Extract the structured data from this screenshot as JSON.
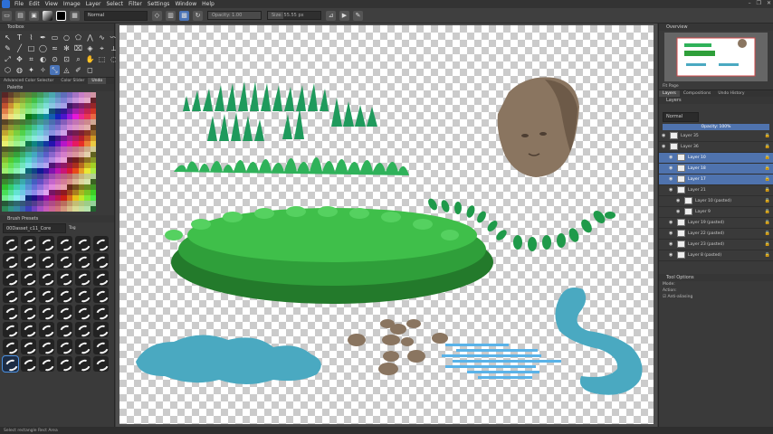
{
  "menu": [
    "File",
    "Edit",
    "View",
    "Image",
    "Layer",
    "Select",
    "Filter",
    "Settings",
    "Window",
    "Help"
  ],
  "toolbar": {
    "blend_mode": "Normal",
    "opacity_label": "Opacity: 1.00",
    "opacity_value": 1.0,
    "size_label": "Size: 55.55 px",
    "size_fraction": 0.3
  },
  "left_dock": {
    "toolbox_title": "Toolbox",
    "tabs": [
      "Advanced Color Selector",
      "Color Slider",
      "Undo"
    ],
    "palette_title": "Palette",
    "brush_title": "Brush Presets",
    "brush_filter": "00Dasset_c11_Core",
    "brush_tag": "Tag"
  },
  "right_dock": {
    "overview_title": "Overview",
    "fit_label": "Fit Page",
    "tabs": [
      "Layers",
      "Compositions",
      "Undo History"
    ],
    "layers_title": "Layers",
    "blend": "Normal",
    "opacity": "Opacity: 100%",
    "layers": [
      {
        "name": "Layer 35",
        "selected": false,
        "indent": 0
      },
      {
        "name": "Layer 36",
        "selected": false,
        "indent": 0
      },
      {
        "name": "Layer 10",
        "selected": true,
        "indent": 1
      },
      {
        "name": "Layer 18",
        "selected": true,
        "indent": 1
      },
      {
        "name": "Layer 17",
        "selected": true,
        "indent": 1
      },
      {
        "name": "Layer 21",
        "selected": false,
        "indent": 1
      },
      {
        "name": "Layer 10 (pasted)",
        "selected": false,
        "indent": 2
      },
      {
        "name": "Layer 9",
        "selected": false,
        "indent": 2
      },
      {
        "name": "Layer 19 (pasted)",
        "selected": false,
        "indent": 1
      },
      {
        "name": "Layer 22 (pasted)",
        "selected": false,
        "indent": 1
      },
      {
        "name": "Layer 23 (pasted)",
        "selected": false,
        "indent": 1
      },
      {
        "name": "Layer 8 (pasted)",
        "selected": false,
        "indent": 1
      }
    ],
    "tool_options_title": "Tool Options",
    "option_mode": "Mode:",
    "option_action": "Action:",
    "option_antialias": "Anti-aliasing"
  },
  "status": "Select rectangle Rect Area",
  "colors": {
    "grass_dark": "#1f9a5c",
    "grass_light": "#2fb25a",
    "bush": "#2f9f3a",
    "water": "#4aa9c1",
    "stone": "#8a7560",
    "selection": "#4f73ae"
  }
}
